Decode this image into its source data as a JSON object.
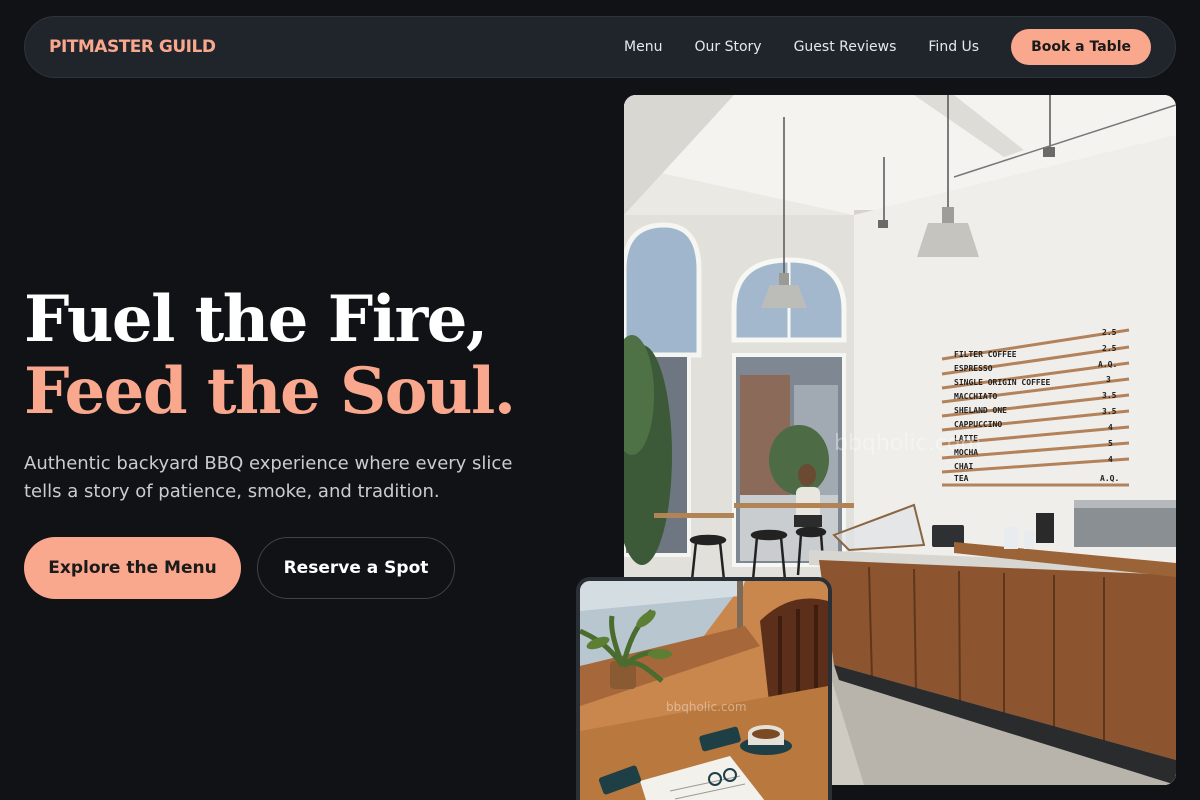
{
  "nav": {
    "brand": "PITMASTER GUILD",
    "links": [
      "Menu",
      "Our Story",
      "Guest Reviews",
      "Find Us"
    ],
    "cta": "Book a Table"
  },
  "hero": {
    "title_line1": "Fuel the Fire,",
    "title_line2": "Feed the Soul.",
    "subtitle": "Authentic backyard BBQ experience where every slice tells a story of patience, smoke, and tradition.",
    "primary_button": "Explore the Menu",
    "secondary_button": "Reserve a Spot"
  },
  "photos": {
    "main_menu_board": [
      {
        "item": "FILTER COFFEE",
        "price": "2.5"
      },
      {
        "item": "ESPRESSO",
        "price": "2.5"
      },
      {
        "item": "SINGLE ORIGIN COFFEE",
        "price": "A.Q."
      },
      {
        "item": "MACCHIATO",
        "price": "3"
      },
      {
        "item": "SHELAND ONE",
        "price": "3.5"
      },
      {
        "item": "CAPPUCCINO",
        "price": "3.5"
      },
      {
        "item": "LATTE",
        "price": "4"
      },
      {
        "item": "MOCHA",
        "price": "5"
      },
      {
        "item": "CHAI",
        "price": "4"
      },
      {
        "item": "TEA",
        "price": "A.Q."
      }
    ],
    "watermark": "bbqholic.com",
    "small_watermark": "bbqholic.com"
  },
  "colors": {
    "background": "#101216",
    "accent": "#f9a78d",
    "navbar": "#20252c"
  }
}
